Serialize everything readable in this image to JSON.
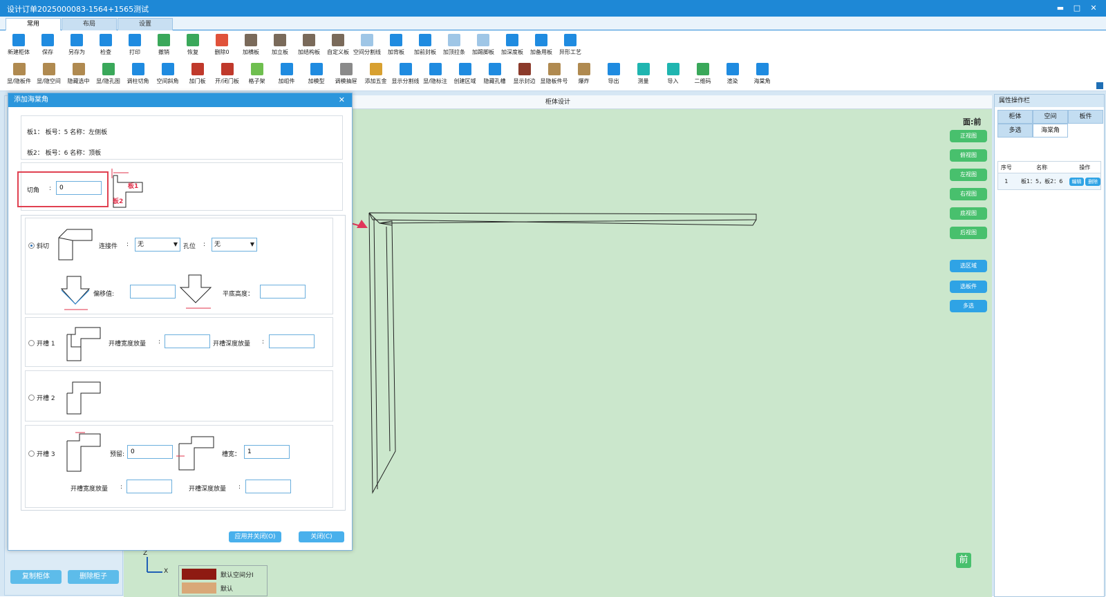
{
  "window": {
    "title": "设计订单2025000083-1564+1565测试"
  },
  "ribbon_tabs": [
    {
      "label": "常用"
    },
    {
      "label": "布局"
    },
    {
      "label": "设置"
    }
  ],
  "toolbar_row1": [
    {
      "label": "新建柜体",
      "icon": "new-cabinet-icon",
      "color": "#1f8be0"
    },
    {
      "label": "保存",
      "icon": "save-icon",
      "color": "#1f8be0"
    },
    {
      "label": "另存为",
      "icon": "save-as-icon",
      "color": "#1f8be0"
    },
    {
      "label": "检查",
      "icon": "check-icon",
      "color": "#1f8be0"
    },
    {
      "label": "打印",
      "icon": "print-icon",
      "color": "#1f8be0"
    },
    {
      "label": "撤销",
      "icon": "undo-icon",
      "color": "#3aa85a"
    },
    {
      "label": "恢复",
      "icon": "redo-icon",
      "color": "#3aa85a"
    },
    {
      "label": "删除0",
      "icon": "delete-icon",
      "color": "#e0523a"
    },
    {
      "label": "加横板",
      "icon": "horizontal-board-icon",
      "color": "#7a6a5a"
    },
    {
      "label": "加立板",
      "icon": "vertical-board-icon",
      "color": "#7a6a5a"
    },
    {
      "label": "加结构板",
      "icon": "structure-board-icon",
      "color": "#7a6a5a"
    },
    {
      "label": "自定义板",
      "icon": "custom-board-icon",
      "color": "#7a6a5a"
    },
    {
      "label": "空间分割线",
      "icon": "space-split-icon",
      "color": "#9fc6e6"
    },
    {
      "label": "加背板",
      "icon": "back-board-icon",
      "color": "#1f8be0"
    },
    {
      "label": "加前封板",
      "icon": "front-seal-icon",
      "color": "#1f8be0"
    },
    {
      "label": "加顶拉条",
      "icon": "top-strip-icon",
      "color": "#9fc6e6"
    },
    {
      "label": "加踢脚板",
      "icon": "kickboard-icon",
      "color": "#9fc6e6"
    },
    {
      "label": "加深度板",
      "icon": "depth-board-icon",
      "color": "#1f8be0"
    },
    {
      "label": "加备用板",
      "icon": "spare-board-icon",
      "color": "#1f8be0"
    },
    {
      "label": "异形工艺",
      "icon": "special-shape-icon",
      "color": "#1f8be0"
    }
  ],
  "toolbar_row2": [
    {
      "label": "显/隐板件",
      "icon": "toggle-boards-icon",
      "color": "#b08a50"
    },
    {
      "label": "显/隐空间",
      "icon": "toggle-space-icon",
      "color": "#b08a50"
    },
    {
      "label": "隐藏选中",
      "icon": "hide-selected-icon",
      "color": "#b08a50"
    },
    {
      "label": "显/隐孔图",
      "icon": "toggle-holes-icon",
      "color": "#3aa85a"
    },
    {
      "label": "调柱切角",
      "icon": "pillar-cut-icon",
      "color": "#1f8be0"
    },
    {
      "label": "空间斜角",
      "icon": "space-bevel-icon",
      "color": "#1f8be0"
    },
    {
      "label": "加门板",
      "icon": "door-panel-icon",
      "color": "#c0392b"
    },
    {
      "label": "开/闭门板",
      "icon": "open-close-door-icon",
      "color": "#c0392b"
    },
    {
      "label": "格子架",
      "icon": "grid-rack-icon",
      "color": "#6fbf4f"
    },
    {
      "label": "加组件",
      "icon": "add-component-icon",
      "color": "#1f8be0"
    },
    {
      "label": "加模型",
      "icon": "add-model-icon",
      "color": "#1f8be0"
    },
    {
      "label": "调模抽屉",
      "icon": "drawer-model-icon",
      "color": "#8a8a8a"
    },
    {
      "label": "添加五金",
      "icon": "hardware-icon",
      "color": "#d8a030"
    },
    {
      "label": "显示分割线",
      "icon": "show-split-line-icon",
      "color": "#1f8be0"
    },
    {
      "label": "显/隐标注",
      "icon": "toggle-dimension-icon",
      "color": "#1f8be0"
    },
    {
      "label": "创建区域",
      "icon": "create-area-icon",
      "color": "#1f8be0"
    },
    {
      "label": "隐藏孔槽",
      "icon": "hide-slot-icon",
      "color": "#1f8be0"
    },
    {
      "label": "显示封边",
      "icon": "show-edge-icon",
      "color": "#8b3a2a"
    },
    {
      "label": "显隐板件号",
      "icon": "board-number-icon",
      "color": "#b08a50"
    },
    {
      "label": "爆炸",
      "icon": "explode-icon",
      "color": "#b08a50"
    },
    {
      "label": "导出",
      "icon": "export-icon",
      "color": "#1f8be0"
    },
    {
      "label": "测量",
      "icon": "measure-icon",
      "color": "#1fb5b0"
    },
    {
      "label": "导入",
      "icon": "import-icon",
      "color": "#1fb5b0"
    },
    {
      "label": "二维码",
      "icon": "qrcode-cloud-icon",
      "color": "#3aa85a"
    },
    {
      "label": "渲染",
      "icon": "render-icon",
      "color": "#1f8be0"
    },
    {
      "label": "海棠角",
      "icon": "begonia-corner-icon",
      "color": "#1f8be0"
    }
  ],
  "canvas": {
    "title": "柜体设计",
    "face_label": "面:前",
    "front_badge": "前"
  },
  "view_buttons": [
    "正视图",
    "俯视图",
    "左视图",
    "右视图",
    "底视图",
    "后视图"
  ],
  "select_buttons": [
    "选区域",
    "选板件",
    "多选"
  ],
  "left_panel": {
    "copy_button": "复制柜体",
    "delete_button": "删除柜子"
  },
  "legend": {
    "item1": "默认空间分I",
    "item2": "默认"
  },
  "axis": {
    "z": "Z",
    "x": "X"
  },
  "right_panel": {
    "title": "属性操作栏",
    "tabs": [
      "柜体",
      "空间",
      "板件",
      "多选",
      "海棠角"
    ],
    "table": {
      "headers": [
        "序号",
        "名称",
        "操作"
      ],
      "rows": [
        {
          "index": "1",
          "name": "板1：5，板2：6",
          "edit": "编辑",
          "delete": "删除"
        }
      ]
    }
  },
  "dialog": {
    "title": "添加海棠角",
    "board1": "板1：  板号：5  名称：左侧板",
    "board2": "板2：  板号：6  名称：顶板",
    "cut_angle_label": "切角",
    "cut_angle_value": "0",
    "diagram_board1": "板1",
    "diagram_board2": "板2",
    "miter": {
      "label": "斜切",
      "connector_label": "连接件",
      "connector_value": "无",
      "hole_label": "孔位",
      "hole_value": "无",
      "offset_label": "偏移值:",
      "flat_height_label": "平底高度："
    },
    "slot1": {
      "label": "开槽 1",
      "width_label": "开槽宽度放量",
      "depth_label": "开槽深度放量"
    },
    "slot2": {
      "label": "开槽 2"
    },
    "slot3": {
      "label": "开槽 3",
      "reserve_label": "预留:",
      "reserve_value": "0",
      "groove_width_label": "槽宽：",
      "groove_width_value": "1",
      "width_label": "开槽宽度放量",
      "depth_label": "开槽深度放量"
    },
    "apply_close": "应用并关闭(O)",
    "close": "关闭(C)"
  }
}
